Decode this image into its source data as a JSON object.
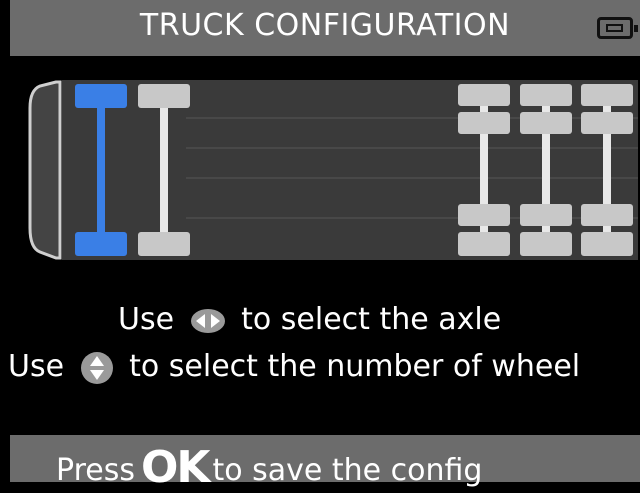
{
  "header": {
    "title": "TRUCK CONFIGURATION",
    "battery_icon": "battery-icon"
  },
  "diagram": {
    "selected_axle": 1,
    "axles": [
      {
        "wheels": 2,
        "selected": true
      },
      {
        "wheels": 2,
        "selected": false
      },
      {
        "wheels": 4,
        "selected": false
      },
      {
        "wheels": 4,
        "selected": false
      },
      {
        "wheels": 4,
        "selected": false
      }
    ],
    "colors": {
      "selected": "#3a7fe6",
      "wheel": "#c8c8c8",
      "chassis": "#3c3c3c"
    }
  },
  "instructions": {
    "line1_prefix": "Use",
    "line1_suffix": "to select the axle",
    "line1_icon": "left-right-arrows-icon",
    "line2_prefix": "Use",
    "line2_suffix": "to select the number of wheel",
    "line2_icon": "up-down-arrows-icon"
  },
  "footer": {
    "prefix": "Press",
    "ok": "OK",
    "suffix": "to save the config"
  }
}
